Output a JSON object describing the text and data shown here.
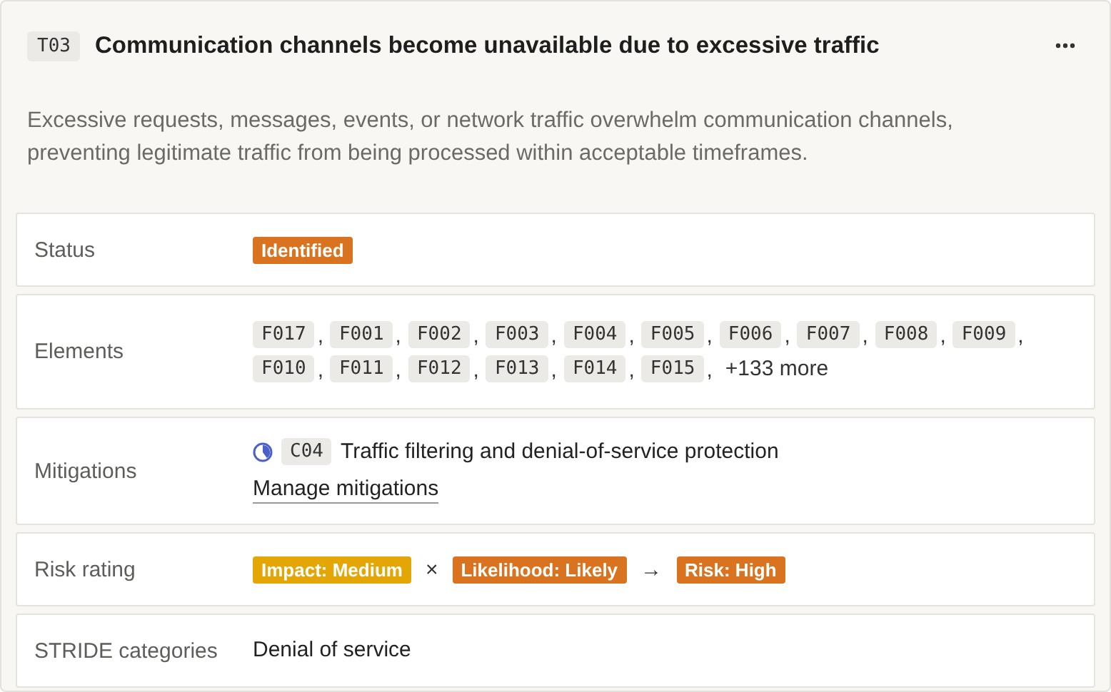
{
  "threat": {
    "id": "T03",
    "title": "Communication channels become unavailable due to excessive traffic",
    "description": "Excessive requests, messages, events, or network traffic overwhelm communication channels, preventing legitimate traffic from being processed within acceptable timeframes."
  },
  "status": {
    "label": "Status",
    "badge": {
      "text": "Identified",
      "color": "#d9731f"
    }
  },
  "elements": {
    "label": "Elements",
    "items": [
      {
        "code": "F017",
        "separator": ","
      },
      {
        "code": "F001",
        "separator": ","
      },
      {
        "code": "F002",
        "separator": ","
      },
      {
        "code": "F003",
        "separator": ","
      },
      {
        "code": "F004",
        "separator": ","
      },
      {
        "code": "F005",
        "separator": ","
      },
      {
        "code": "F006",
        "separator": ","
      },
      {
        "code": "F007",
        "separator": ","
      },
      {
        "code": "F008",
        "separator": ","
      },
      {
        "code": "F009",
        "separator": ","
      },
      {
        "code": "F010",
        "separator": ","
      },
      {
        "code": "F011",
        "separator": ","
      },
      {
        "code": "F012",
        "separator": ","
      },
      {
        "code": "F013",
        "separator": ","
      },
      {
        "code": "F014",
        "separator": ","
      },
      {
        "code": "F015",
        "separator": ","
      }
    ],
    "more": "+133 more"
  },
  "mitigations": {
    "label": "Mitigations",
    "items": [
      {
        "code": "C04",
        "title": "Traffic filtering and denial-of-service protection"
      }
    ],
    "manage_link": "Manage mitigations"
  },
  "risk_rating": {
    "label": "Risk rating",
    "parts": [
      {
        "kind": "badge",
        "text": "Impact: Medium",
        "color": "#e3a605"
      },
      {
        "kind": "operator",
        "text": "×"
      },
      {
        "kind": "badge",
        "text": "Likelihood: Likely",
        "color": "#d9731f"
      },
      {
        "kind": "operator",
        "text": "→"
      },
      {
        "kind": "badge",
        "text": "Risk: High",
        "color": "#d9731f"
      }
    ]
  },
  "stride": {
    "label": "STRIDE categories",
    "value": "Denial of service"
  }
}
